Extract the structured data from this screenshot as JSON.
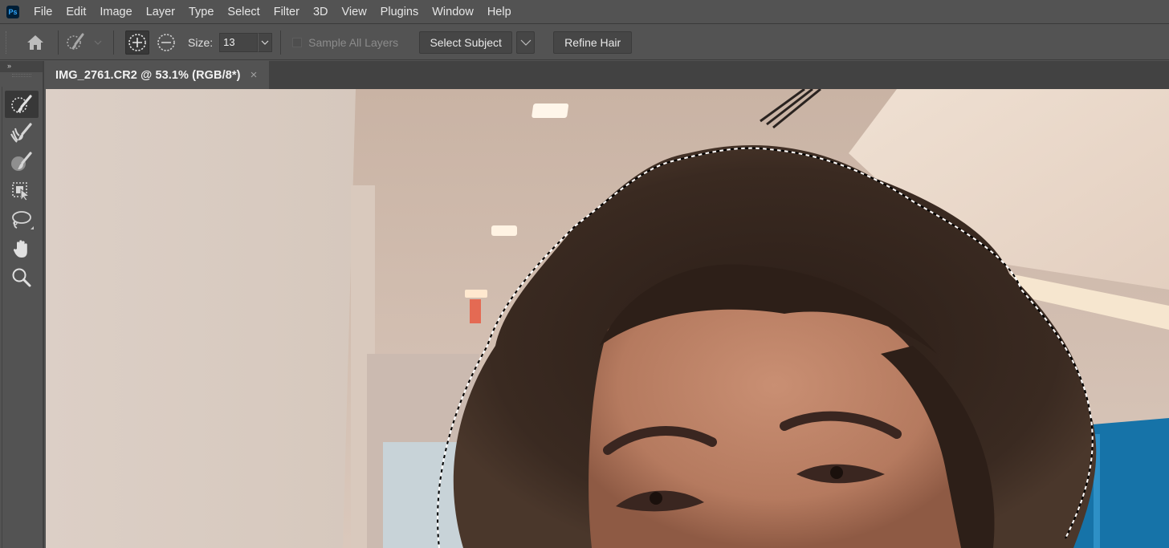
{
  "app": {
    "logo": "Ps",
    "name": "Photoshop"
  },
  "menu": [
    "File",
    "Edit",
    "Image",
    "Layer",
    "Type",
    "Select",
    "Filter",
    "3D",
    "View",
    "Plugins",
    "Window",
    "Help"
  ],
  "options_bar": {
    "home_icon": "home-icon",
    "tool_preset_icon": "quick-selection-brush-icon",
    "mode_add_icon": "add-to-selection-icon",
    "mode_subtract_icon": "subtract-from-selection-icon",
    "size_label": "Size:",
    "size_value": "13",
    "sample_all_layers_label": "Sample All Layers",
    "sample_all_layers_checked": false,
    "select_subject_label": "Select Subject",
    "refine_hair_label": "Refine Hair"
  },
  "tools_panel": {
    "collapse_label": "»",
    "tools": [
      {
        "name": "quick-selection-tool",
        "icon": "quick-selection-icon",
        "active": true
      },
      {
        "name": "refine-edge-brush-tool",
        "icon": "refine-edge-brush-icon",
        "active": false
      },
      {
        "name": "brush-tool",
        "icon": "brush-icon",
        "active": false
      },
      {
        "name": "object-selection-tool",
        "icon": "object-selection-icon",
        "active": false
      },
      {
        "name": "lasso-tool",
        "icon": "lasso-icon",
        "active": false
      },
      {
        "name": "hand-tool",
        "icon": "hand-icon",
        "active": false
      },
      {
        "name": "zoom-tool",
        "icon": "zoom-icon",
        "active": false
      }
    ]
  },
  "document": {
    "tab_title": "IMG_2761.CR2 @ 53.1% (RGB/8*)",
    "close_glyph": "×",
    "zoom_percent": 53.1,
    "color_mode": "RGB/8*"
  },
  "colors": {
    "ui_bg": "#535353",
    "panel_dark": "#424242",
    "active_tool": "#383838",
    "ps_blue": "#31a8ff",
    "ps_logo_bg": "#001e36"
  }
}
